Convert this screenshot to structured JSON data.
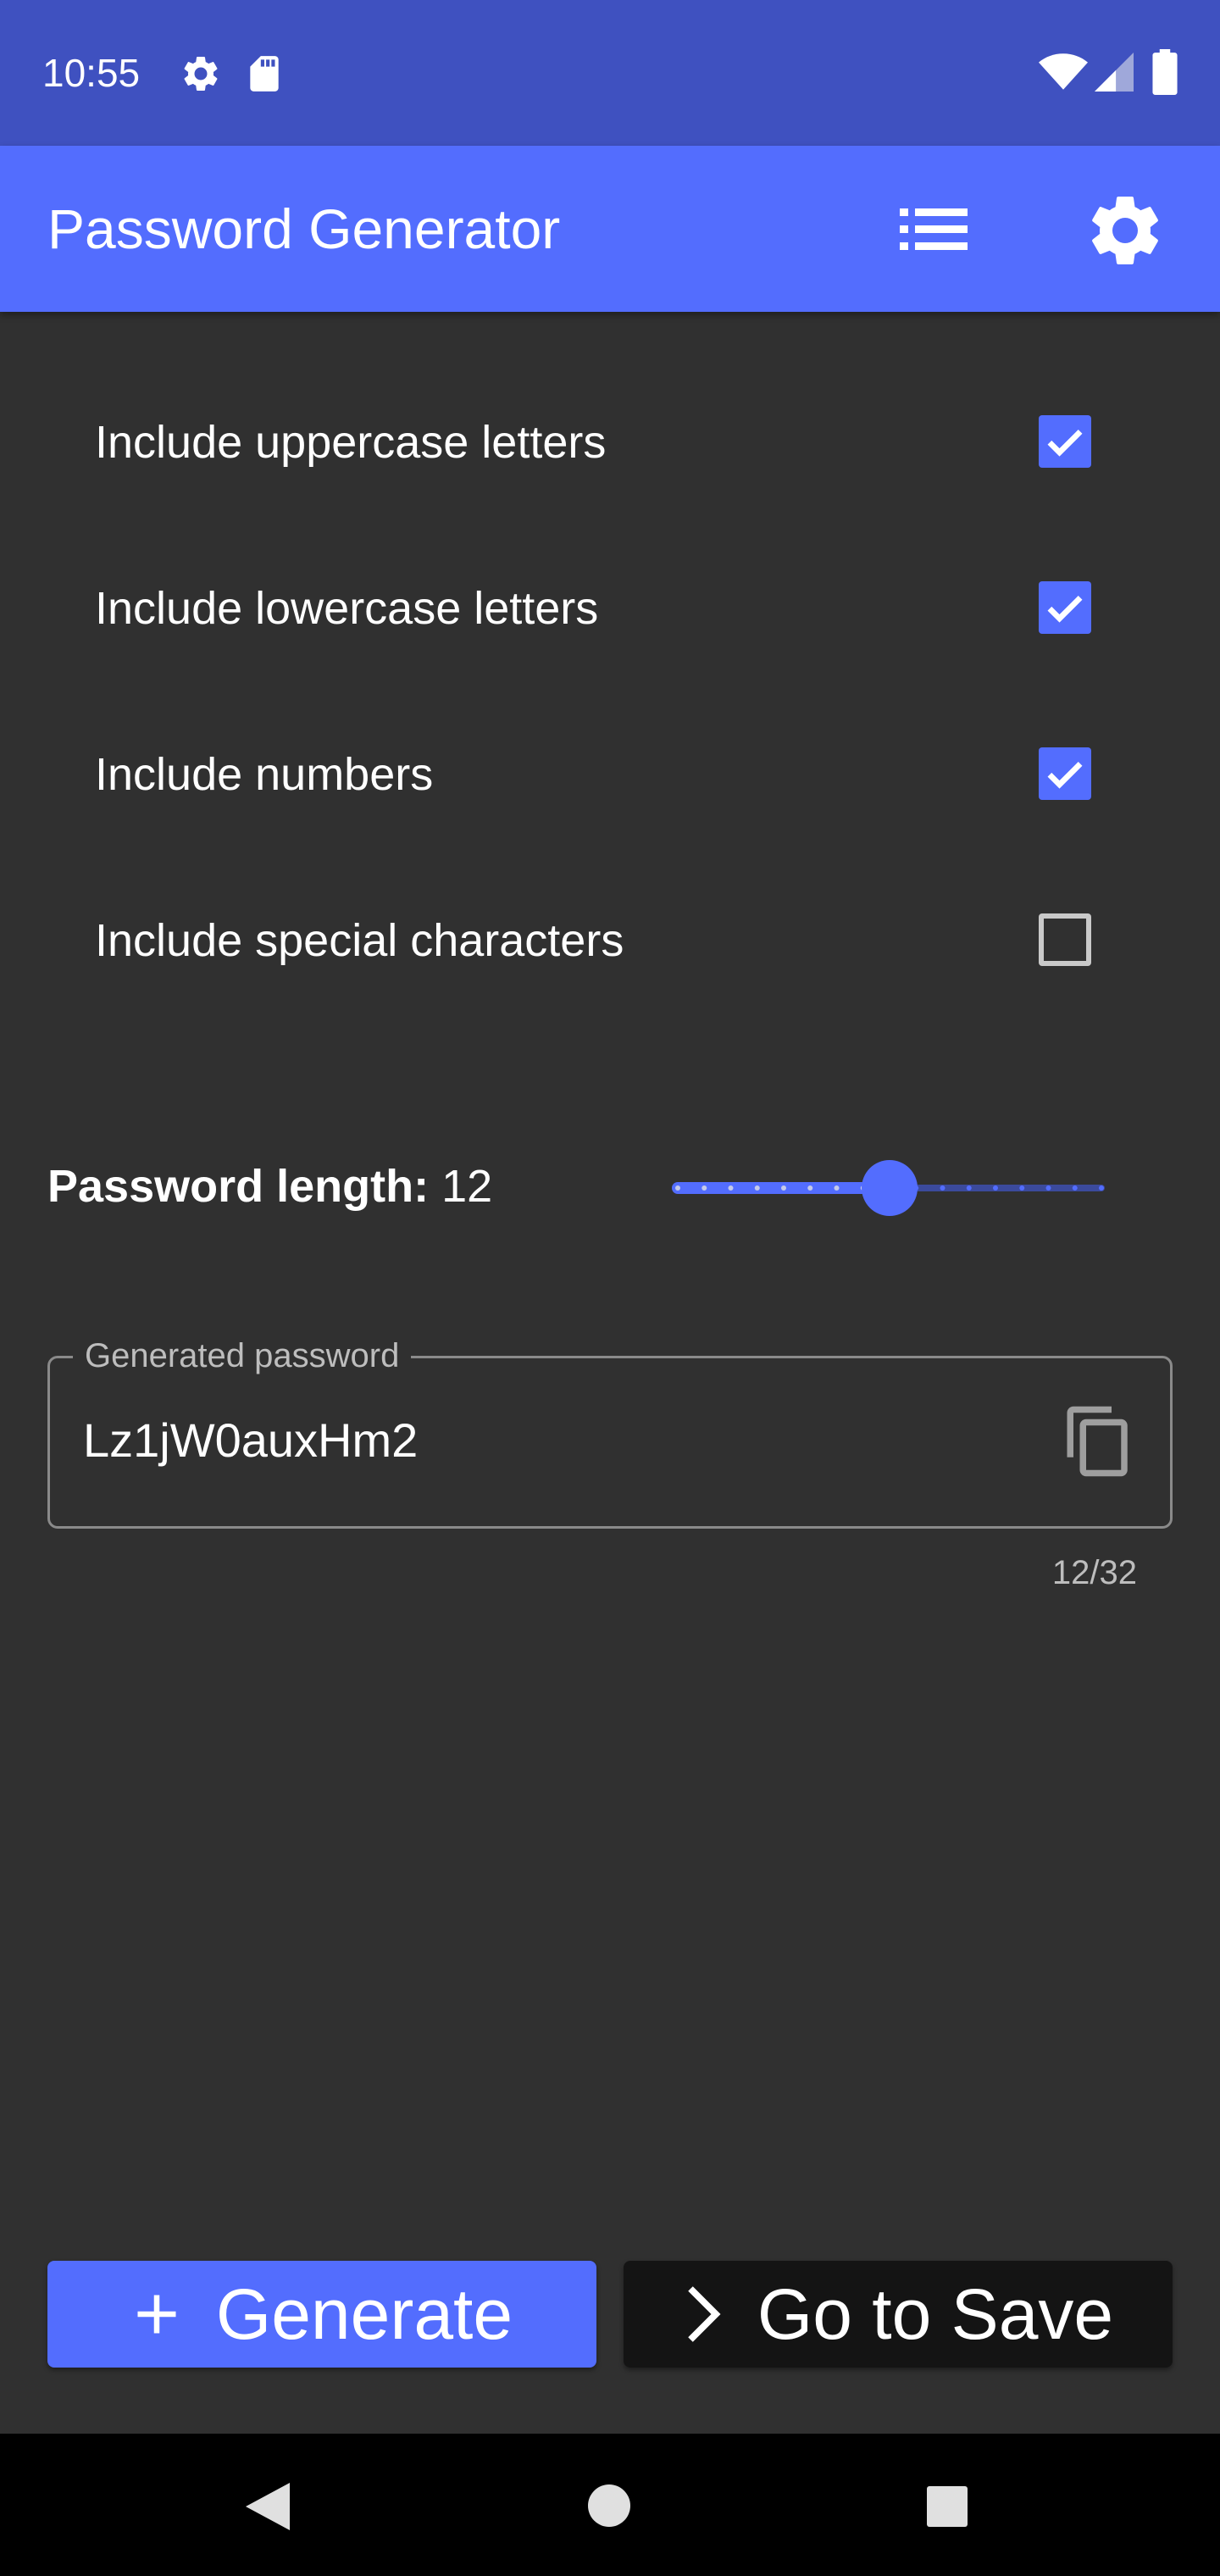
{
  "status_bar": {
    "time": "10:55",
    "icons": [
      "gear-icon",
      "sd-card-icon",
      "wifi-icon",
      "signal-icon",
      "battery-icon"
    ]
  },
  "app_bar": {
    "title": "Password Generator",
    "actions": [
      "list-icon",
      "settings-icon"
    ]
  },
  "options": [
    {
      "label": "Include uppercase letters",
      "checked": true
    },
    {
      "label": "Include lowercase letters",
      "checked": true
    },
    {
      "label": "Include numbers",
      "checked": true
    },
    {
      "label": "Include special characters",
      "checked": false
    }
  ],
  "length": {
    "label": "Password length:",
    "value": "12",
    "min": 4,
    "max": 20,
    "current": 12
  },
  "generated": {
    "label": "Generated password",
    "value": "Lz1jW0auxHm2",
    "counter": "12/32"
  },
  "buttons": {
    "generate": "Generate",
    "go_to_save": "Go to Save"
  },
  "colors": {
    "status_bar": "#3f51c0",
    "primary": "#536dfe",
    "background": "#303030",
    "dark_button": "#141414"
  }
}
